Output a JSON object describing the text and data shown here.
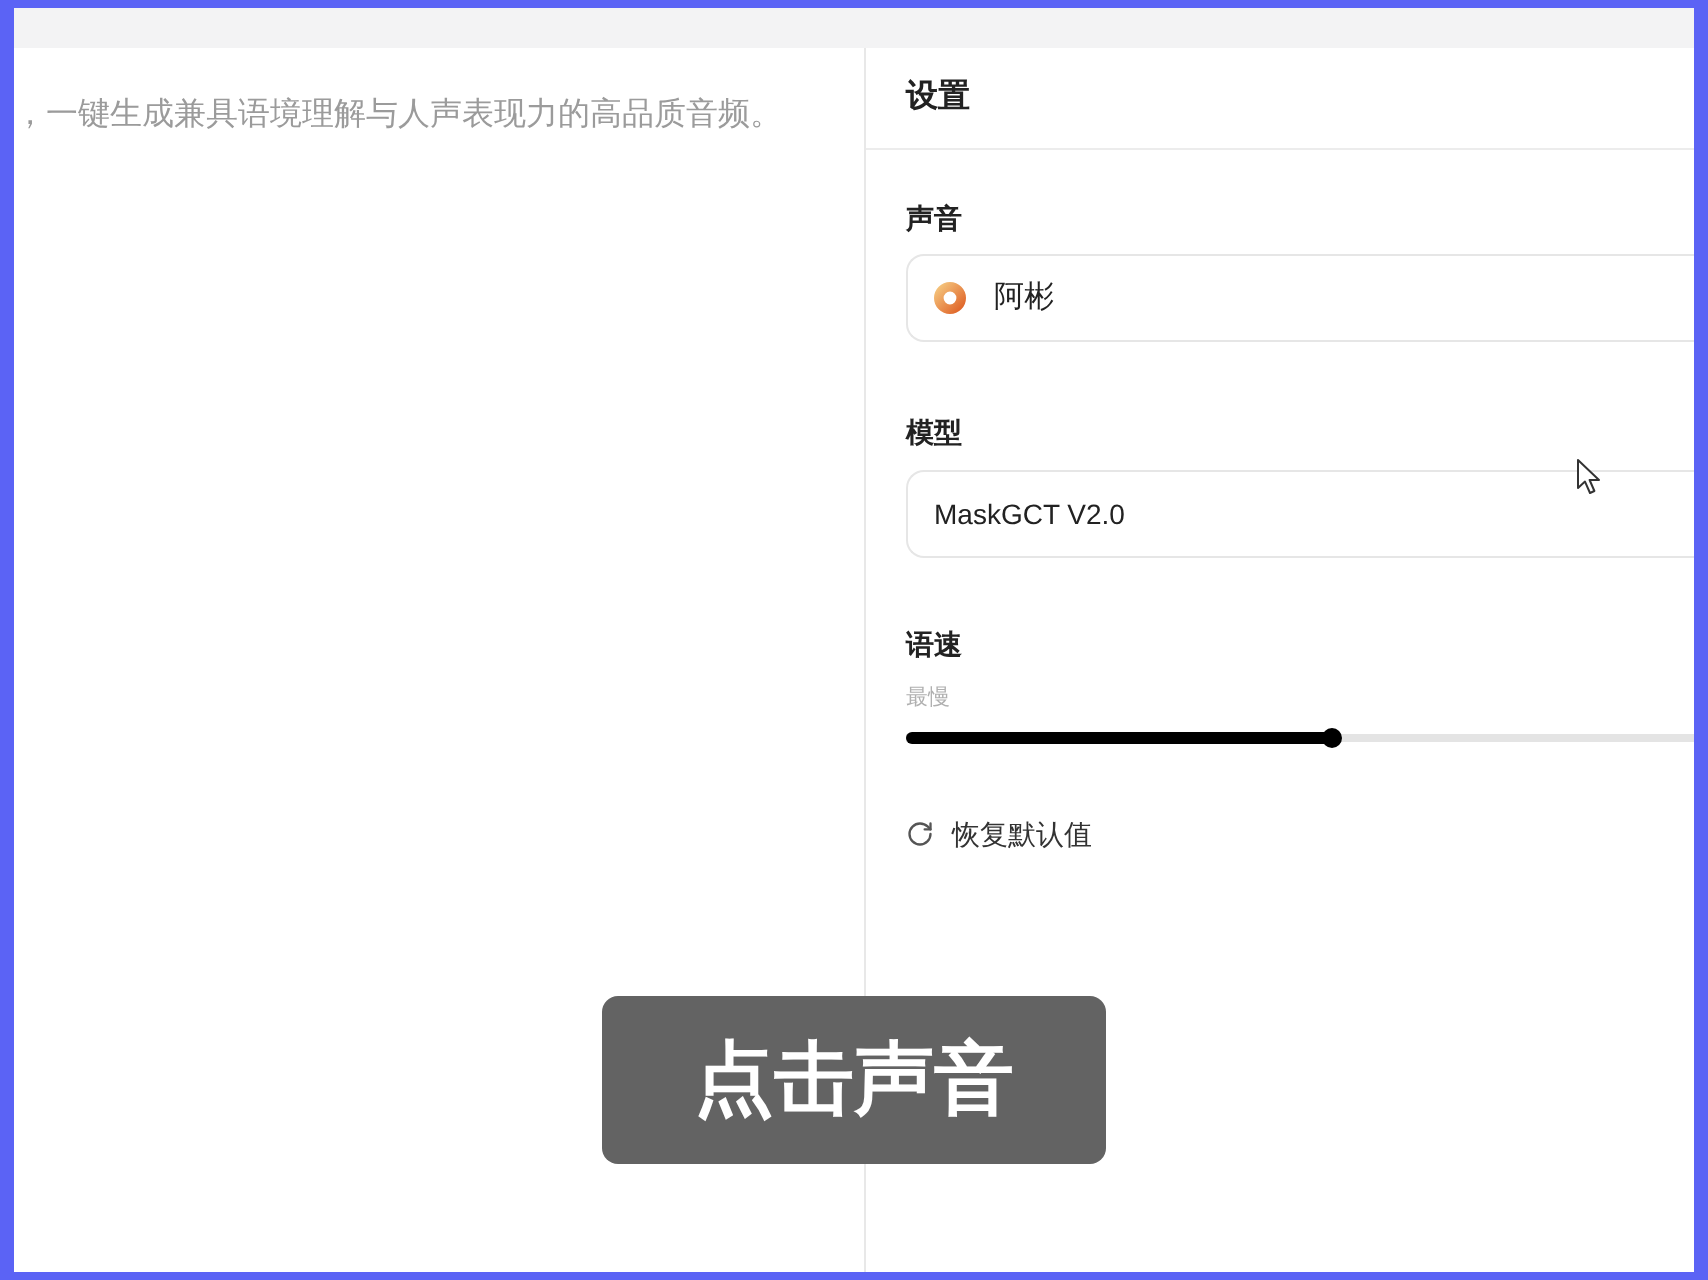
{
  "intro": {
    "text": "，一键生成兼具语境理解与人声表现力的高品质音频。"
  },
  "settings": {
    "title": "设置",
    "voice": {
      "label": "声音",
      "value": "阿彬"
    },
    "model": {
      "label": "模型",
      "value": "MaskGCT V2.0"
    },
    "speed": {
      "label": "语速",
      "min_label": "最慢",
      "level": 0.54
    },
    "reset": {
      "label": "恢复默认值"
    }
  },
  "caption": {
    "text": "点击声音"
  }
}
